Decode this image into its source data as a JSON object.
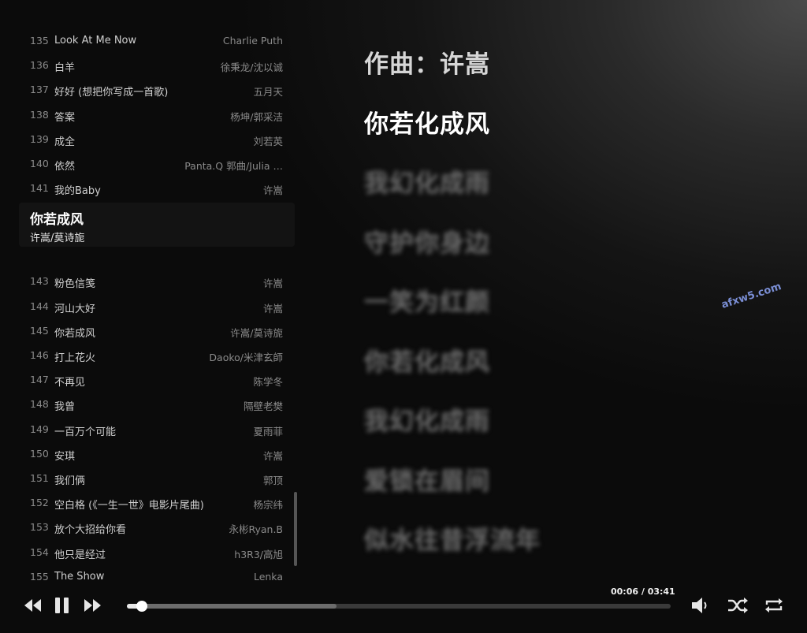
{
  "playlist": [
    {
      "num": "135",
      "title": "Look At Me Now",
      "artist": "Charlie Puth"
    },
    {
      "num": "136",
      "title": "白羊",
      "artist": "徐秉龙/沈以诚"
    },
    {
      "num": "137",
      "title": "好好 (想把你写成一首歌)",
      "artist": "五月天"
    },
    {
      "num": "138",
      "title": "答案",
      "artist": "杨坤/郭采洁"
    },
    {
      "num": "139",
      "title": "成全",
      "artist": "刘若英"
    },
    {
      "num": "140",
      "title": "依然",
      "artist": "Panta.Q 郭曲/Julia …"
    },
    {
      "num": "141",
      "title": "我的Baby",
      "artist": "许嵩"
    },
    {
      "num": "",
      "title": "你若成风",
      "artist": "许嵩/莫诗旎",
      "active": true
    },
    {
      "num": "143",
      "title": "粉色信笺",
      "artist": "许嵩"
    },
    {
      "num": "144",
      "title": "河山大好",
      "artist": "许嵩"
    },
    {
      "num": "145",
      "title": "你若成风",
      "artist": "许嵩/莫诗旎"
    },
    {
      "num": "146",
      "title": "打上花火",
      "artist": "Daoko/米津玄師"
    },
    {
      "num": "147",
      "title": "不再见",
      "artist": "陈学冬"
    },
    {
      "num": "148",
      "title": "我曾",
      "artist": "隔壁老樊"
    },
    {
      "num": "149",
      "title": "一百万个可能",
      "artist": "夏雨菲"
    },
    {
      "num": "150",
      "title": "安琪",
      "artist": "许嵩"
    },
    {
      "num": "151",
      "title": "我们俩",
      "artist": "郭顶"
    },
    {
      "num": "152",
      "title": "空白格 (《一生一世》电影片尾曲)",
      "artist": "杨宗纬"
    },
    {
      "num": "153",
      "title": "放个大招给你看",
      "artist": "永彬Ryan.B"
    },
    {
      "num": "154",
      "title": "他只是经过",
      "artist": "h3R3/高旭"
    },
    {
      "num": "155",
      "title": "The Show",
      "artist": "Lenka"
    }
  ],
  "lyrics": [
    {
      "text": "作曲：许嵩",
      "state": "top"
    },
    {
      "text": "你若化成风",
      "state": "current"
    },
    {
      "text": "我幻化成雨",
      "state": "blur"
    },
    {
      "text": "守护你身边",
      "state": "blur"
    },
    {
      "text": "一笑为红颜",
      "state": "blur"
    },
    {
      "text": "你若化成风",
      "state": "blur"
    },
    {
      "text": "我幻化成雨",
      "state": "blur"
    },
    {
      "text": "爱锁在眉间",
      "state": "blur"
    },
    {
      "text": "似水往昔浮流年",
      "state": "blur"
    }
  ],
  "watermark": "afxw5.com",
  "player": {
    "time": "00:06 / 03:41",
    "progress": 0.027,
    "buffered": 0.385,
    "icons": [
      "prev-icon",
      "pause-icon",
      "next-icon",
      "volume-icon",
      "shuffle-icon",
      "repeat-icon"
    ]
  }
}
